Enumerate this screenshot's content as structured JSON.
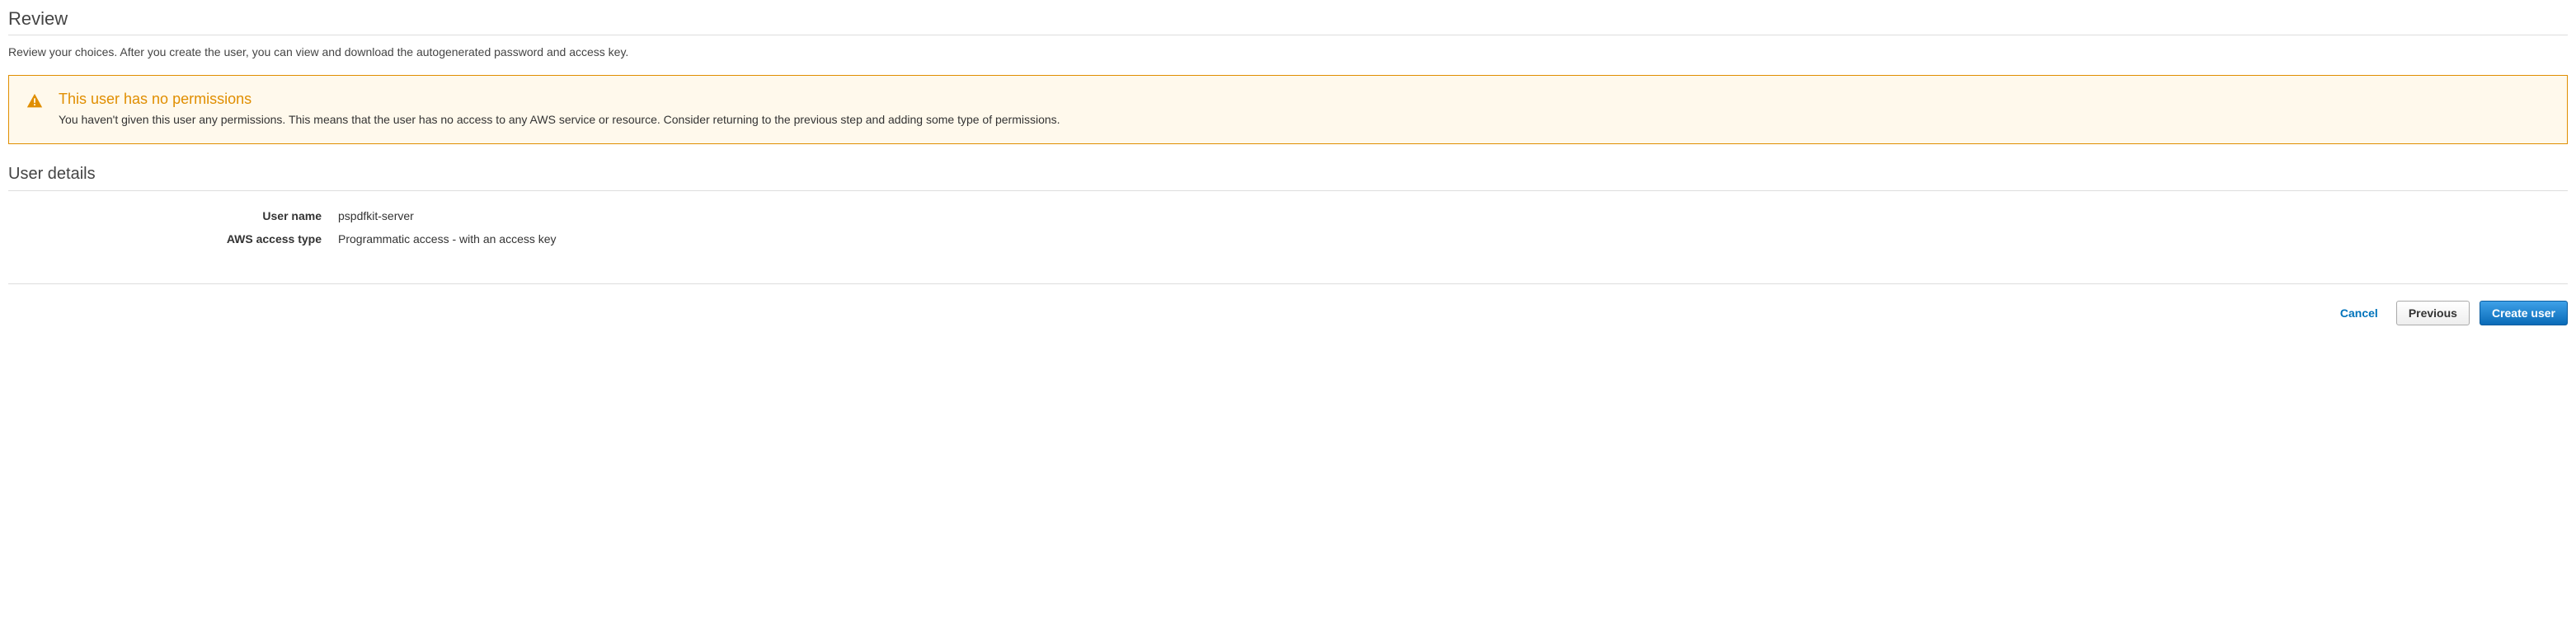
{
  "review": {
    "title": "Review",
    "description": "Review your choices. After you create the user, you can view and download the autogenerated password and access key."
  },
  "alert": {
    "title": "This user has no permissions",
    "message": "You haven't given this user any permissions. This means that the user has no access to any AWS service or resource. Consider returning to the previous step and adding some type of permissions."
  },
  "user_details": {
    "title": "User details",
    "labels": {
      "user_name": "User name",
      "access_type": "AWS access type"
    },
    "values": {
      "user_name": "pspdfkit-server",
      "access_type": "Programmatic access - with an access key"
    }
  },
  "actions": {
    "cancel": "Cancel",
    "previous": "Previous",
    "create": "Create user"
  }
}
